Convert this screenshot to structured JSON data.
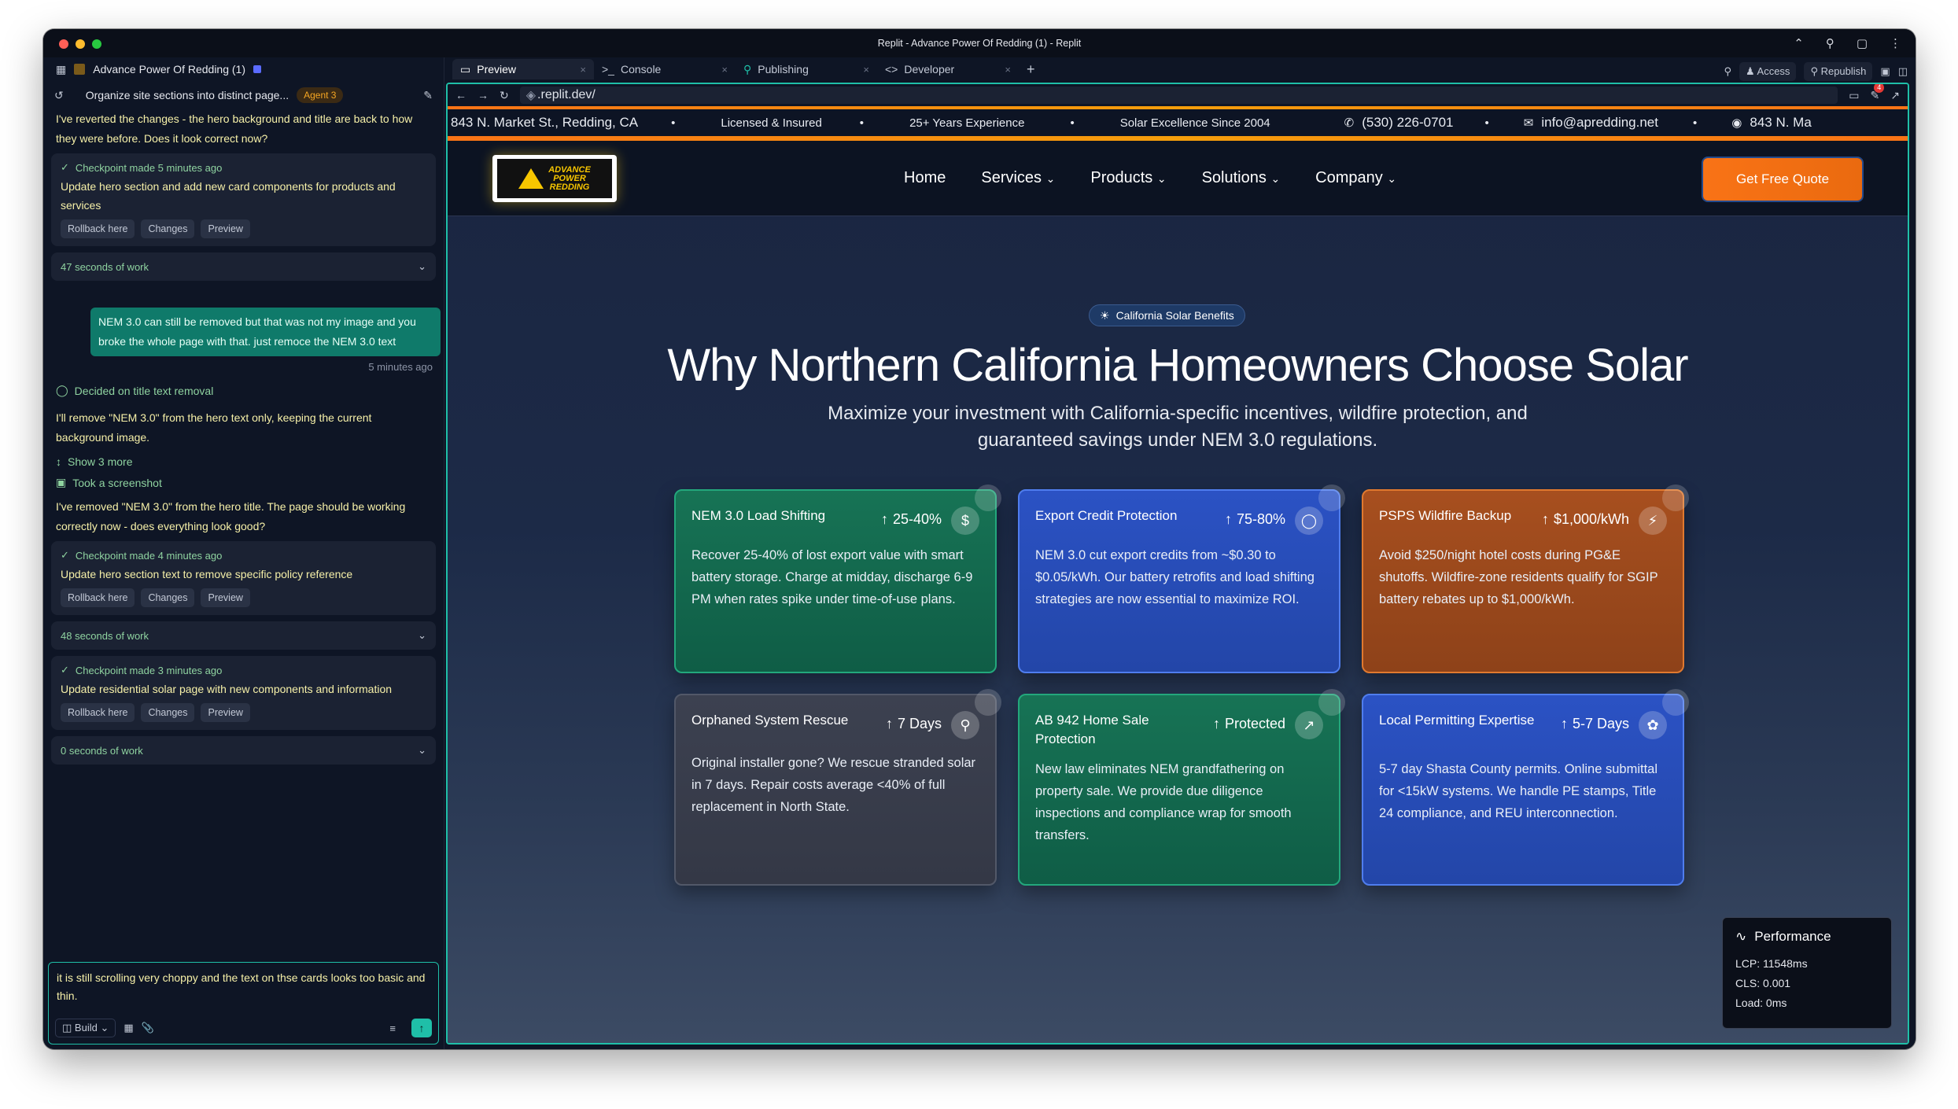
{
  "window": {
    "title": "Replit - Advance Power Of Redding (1) - Replit",
    "traffic_lights": [
      "#ff5f57",
      "#febc2e",
      "#28c840"
    ]
  },
  "left_panel": {
    "project_name": "Advance Power Of Redding (1)",
    "task_title": "Organize site sections into distinct page...",
    "agent_badge": "Agent 3",
    "messages": [
      {
        "type": "agent",
        "text": "I've reverted the changes - the hero background and title are back to how they were before. Does it look correct now?"
      },
      {
        "type": "checkpoint",
        "head": "Checkpoint made 5 minutes ago",
        "body": "Update hero section and add new card components for products and services",
        "buttons": [
          "Rollback here",
          "Changes",
          "Preview"
        ]
      },
      {
        "type": "work",
        "text": "47 seconds of work"
      },
      {
        "type": "user",
        "text": "NEM 3.0 can still be removed but that was not my image and you broke the whole page with that. just remoce the NEM 3.0 text",
        "meta": "5 minutes ago"
      },
      {
        "type": "event",
        "text": "Decided on title text removal"
      },
      {
        "type": "agent",
        "text": "I'll remove \"NEM 3.0\" from the hero text only, keeping the current background image."
      },
      {
        "type": "event",
        "text": "Show 3 more"
      },
      {
        "type": "event",
        "text": "Took a screenshot"
      },
      {
        "type": "agent",
        "text": "I've removed \"NEM 3.0\" from the hero title. The page should be working correctly now - does everything look good?"
      },
      {
        "type": "checkpoint",
        "head": "Checkpoint made 4 minutes ago",
        "body": "Update hero section text to remove specific policy reference",
        "buttons": [
          "Rollback here",
          "Changes",
          "Preview"
        ]
      },
      {
        "type": "work",
        "text": "48 seconds of work"
      },
      {
        "type": "checkpoint",
        "head": "Checkpoint made 3 minutes ago",
        "body": "Update residential solar page with new components and information",
        "buttons": [
          "Rollback here",
          "Changes",
          "Preview"
        ]
      },
      {
        "type": "work",
        "text": "0 seconds of work"
      }
    ],
    "composer_text": "it is still scrolling very choppy and the text on thse cards looks too basic and thin.",
    "composer_mode": "Build"
  },
  "right_pane": {
    "tabs": [
      {
        "label": "Preview",
        "active": true
      },
      {
        "label": "Console",
        "active": false
      },
      {
        "label": "Publishing",
        "active": false
      },
      {
        "label": "Developer",
        "active": false
      }
    ],
    "toolbar": {
      "access": "Access",
      "republish": "Republish"
    },
    "url": ".replit.dev/",
    "notification_count": "4"
  },
  "site": {
    "infobar": {
      "address": "843 N. Market St., Redding, CA",
      "licensed": "Licensed & Insured",
      "years": "25+ Years Experience",
      "since": "Solar Excellence Since 2004",
      "phone": "(530) 226-0701",
      "email": "info@apredding.net",
      "address_repeat": "843 N. Ma"
    },
    "logo_lines": [
      "ADVANCE",
      "POWER",
      "REDDING"
    ],
    "nav": {
      "home": "Home",
      "services": "Services",
      "products": "Products",
      "solutions": "Solutions",
      "company": "Company",
      "cta": "Get Free Quote"
    },
    "hero": {
      "pill": "California Solar Benefits",
      "title": "Why Northern California Homeowners Choose Solar",
      "subtitle_line1": "Maximize your investment with California-specific incentives, wildfire protection, and",
      "subtitle_line2": "guaranteed savings under NEM 3.0 regulations."
    },
    "cards": [
      {
        "title": "NEM 3.0 Load Shifting",
        "stat": "25-40%",
        "icon": "dollar-icon",
        "desc": "Recover 25-40% of lost export value with smart battery storage. Charge at midday, discharge 6-9 PM when rates spike under time-of-use plans.",
        "color": "green"
      },
      {
        "title": "Export Credit Protection",
        "stat": "75-80%",
        "icon": "shield-icon",
        "desc": "NEM 3.0 cut export credits from ~$0.30 to $0.05/kWh. Our battery retrofits and load shifting strategies are now essential to maximize ROI.",
        "color": "blue"
      },
      {
        "title": "PSPS Wildfire Backup",
        "stat": "$1,000/kWh",
        "icon": "lightning-icon",
        "desc": "Avoid $250/night hotel costs during PG&E shutoffs. Wildfire-zone residents qualify for SGIP battery rebates up to $1,000/kWh.",
        "color": "orange"
      },
      {
        "title": "Orphaned System Rescue",
        "stat": "7 Days",
        "icon": "award-icon",
        "desc": "Original installer gone? We rescue stranded solar in 7 days. Repair costs average <40% of full replacement in North State.",
        "color": "gray"
      },
      {
        "title": "AB 942 Home Sale Protection",
        "stat": "Protected",
        "icon": "trending-up-icon",
        "desc": "New law eliminates NEM grandfathering on property sale. We provide due diligence inspections and compliance wrap for smooth transfers.",
        "color": "green"
      },
      {
        "title": "Local Permitting Expertise",
        "stat": "5-7 Days",
        "icon": "leaf-icon",
        "desc": "5-7 day Shasta County permits. Online submittal for <15kW systems. We handle PE stamps, Title 24 compliance, and REU interconnection.",
        "color": "blue"
      }
    ],
    "perf": {
      "title": "Performance",
      "lcp": "LCP: 11548ms",
      "cls": "CLS: 0.001",
      "load": "Load: 0ms"
    }
  }
}
